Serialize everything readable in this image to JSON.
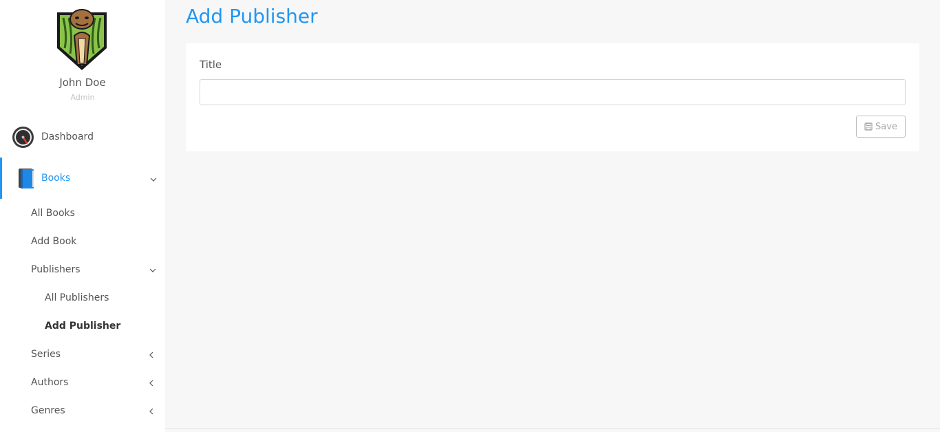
{
  "profile": {
    "name": "John Doe",
    "role": "Admin",
    "avatar_icon": "cobra-avatar"
  },
  "nav": {
    "dashboard": {
      "label": "Dashboard",
      "icon": "speedometer-icon"
    },
    "books": {
      "label": "Books",
      "icon": "book-icon",
      "active": true,
      "children": {
        "all_books": "All Books",
        "add_book": "Add Book",
        "publishers": {
          "label": "Publishers",
          "children": {
            "all": "All Publishers",
            "add": "Add Publisher"
          }
        },
        "series": "Series",
        "authors": "Authors",
        "genres": "Genres"
      }
    }
  },
  "main": {
    "title": "Add Publisher",
    "form": {
      "title_label": "Title",
      "title_value": "",
      "save_label": "Save",
      "save_icon": "floppy-disk-icon"
    }
  },
  "colors": {
    "accent": "#2196f3",
    "background": "#f7f7f7",
    "sidebar": "#ffffff"
  }
}
